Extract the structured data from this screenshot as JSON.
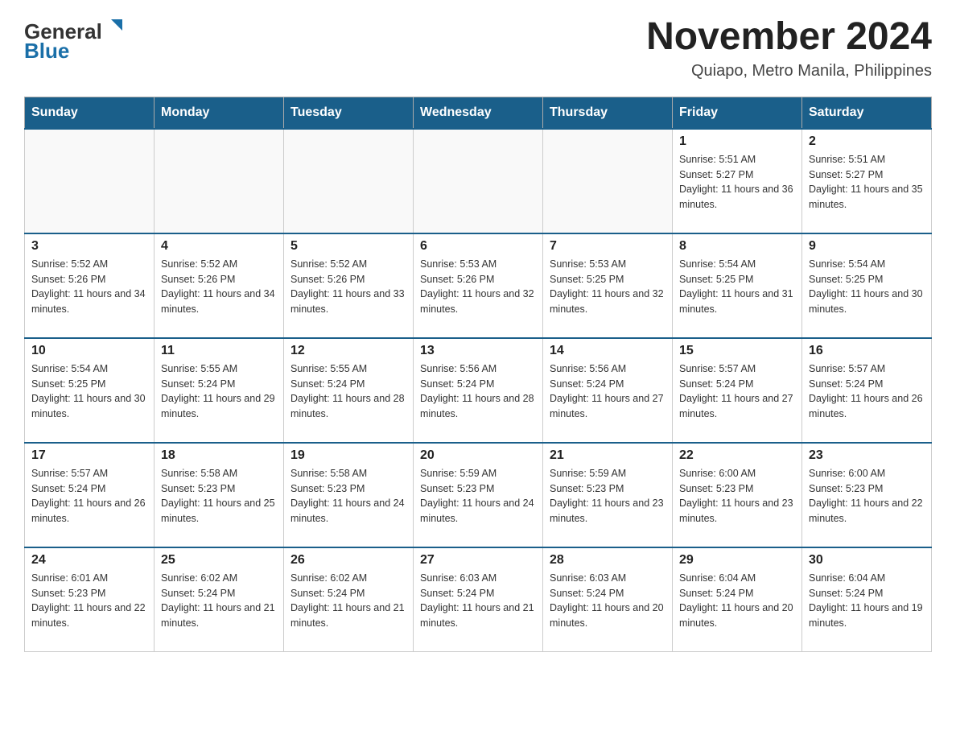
{
  "header": {
    "logo": {
      "general": "General",
      "blue": "Blue"
    },
    "title": "November 2024",
    "location": "Quiapo, Metro Manila, Philippines"
  },
  "calendar": {
    "days_of_week": [
      "Sunday",
      "Monday",
      "Tuesday",
      "Wednesday",
      "Thursday",
      "Friday",
      "Saturday"
    ],
    "weeks": [
      [
        {
          "day": "",
          "info": ""
        },
        {
          "day": "",
          "info": ""
        },
        {
          "day": "",
          "info": ""
        },
        {
          "day": "",
          "info": ""
        },
        {
          "day": "",
          "info": ""
        },
        {
          "day": "1",
          "info": "Sunrise: 5:51 AM\nSunset: 5:27 PM\nDaylight: 11 hours and 36 minutes."
        },
        {
          "day": "2",
          "info": "Sunrise: 5:51 AM\nSunset: 5:27 PM\nDaylight: 11 hours and 35 minutes."
        }
      ],
      [
        {
          "day": "3",
          "info": "Sunrise: 5:52 AM\nSunset: 5:26 PM\nDaylight: 11 hours and 34 minutes."
        },
        {
          "day": "4",
          "info": "Sunrise: 5:52 AM\nSunset: 5:26 PM\nDaylight: 11 hours and 34 minutes."
        },
        {
          "day": "5",
          "info": "Sunrise: 5:52 AM\nSunset: 5:26 PM\nDaylight: 11 hours and 33 minutes."
        },
        {
          "day": "6",
          "info": "Sunrise: 5:53 AM\nSunset: 5:26 PM\nDaylight: 11 hours and 32 minutes."
        },
        {
          "day": "7",
          "info": "Sunrise: 5:53 AM\nSunset: 5:25 PM\nDaylight: 11 hours and 32 minutes."
        },
        {
          "day": "8",
          "info": "Sunrise: 5:54 AM\nSunset: 5:25 PM\nDaylight: 11 hours and 31 minutes."
        },
        {
          "day": "9",
          "info": "Sunrise: 5:54 AM\nSunset: 5:25 PM\nDaylight: 11 hours and 30 minutes."
        }
      ],
      [
        {
          "day": "10",
          "info": "Sunrise: 5:54 AM\nSunset: 5:25 PM\nDaylight: 11 hours and 30 minutes."
        },
        {
          "day": "11",
          "info": "Sunrise: 5:55 AM\nSunset: 5:24 PM\nDaylight: 11 hours and 29 minutes."
        },
        {
          "day": "12",
          "info": "Sunrise: 5:55 AM\nSunset: 5:24 PM\nDaylight: 11 hours and 28 minutes."
        },
        {
          "day": "13",
          "info": "Sunrise: 5:56 AM\nSunset: 5:24 PM\nDaylight: 11 hours and 28 minutes."
        },
        {
          "day": "14",
          "info": "Sunrise: 5:56 AM\nSunset: 5:24 PM\nDaylight: 11 hours and 27 minutes."
        },
        {
          "day": "15",
          "info": "Sunrise: 5:57 AM\nSunset: 5:24 PM\nDaylight: 11 hours and 27 minutes."
        },
        {
          "day": "16",
          "info": "Sunrise: 5:57 AM\nSunset: 5:24 PM\nDaylight: 11 hours and 26 minutes."
        }
      ],
      [
        {
          "day": "17",
          "info": "Sunrise: 5:57 AM\nSunset: 5:24 PM\nDaylight: 11 hours and 26 minutes."
        },
        {
          "day": "18",
          "info": "Sunrise: 5:58 AM\nSunset: 5:23 PM\nDaylight: 11 hours and 25 minutes."
        },
        {
          "day": "19",
          "info": "Sunrise: 5:58 AM\nSunset: 5:23 PM\nDaylight: 11 hours and 24 minutes."
        },
        {
          "day": "20",
          "info": "Sunrise: 5:59 AM\nSunset: 5:23 PM\nDaylight: 11 hours and 24 minutes."
        },
        {
          "day": "21",
          "info": "Sunrise: 5:59 AM\nSunset: 5:23 PM\nDaylight: 11 hours and 23 minutes."
        },
        {
          "day": "22",
          "info": "Sunrise: 6:00 AM\nSunset: 5:23 PM\nDaylight: 11 hours and 23 minutes."
        },
        {
          "day": "23",
          "info": "Sunrise: 6:00 AM\nSunset: 5:23 PM\nDaylight: 11 hours and 22 minutes."
        }
      ],
      [
        {
          "day": "24",
          "info": "Sunrise: 6:01 AM\nSunset: 5:23 PM\nDaylight: 11 hours and 22 minutes."
        },
        {
          "day": "25",
          "info": "Sunrise: 6:02 AM\nSunset: 5:24 PM\nDaylight: 11 hours and 21 minutes."
        },
        {
          "day": "26",
          "info": "Sunrise: 6:02 AM\nSunset: 5:24 PM\nDaylight: 11 hours and 21 minutes."
        },
        {
          "day": "27",
          "info": "Sunrise: 6:03 AM\nSunset: 5:24 PM\nDaylight: 11 hours and 21 minutes."
        },
        {
          "day": "28",
          "info": "Sunrise: 6:03 AM\nSunset: 5:24 PM\nDaylight: 11 hours and 20 minutes."
        },
        {
          "day": "29",
          "info": "Sunrise: 6:04 AM\nSunset: 5:24 PM\nDaylight: 11 hours and 20 minutes."
        },
        {
          "day": "30",
          "info": "Sunrise: 6:04 AM\nSunset: 5:24 PM\nDaylight: 11 hours and 19 minutes."
        }
      ]
    ]
  }
}
